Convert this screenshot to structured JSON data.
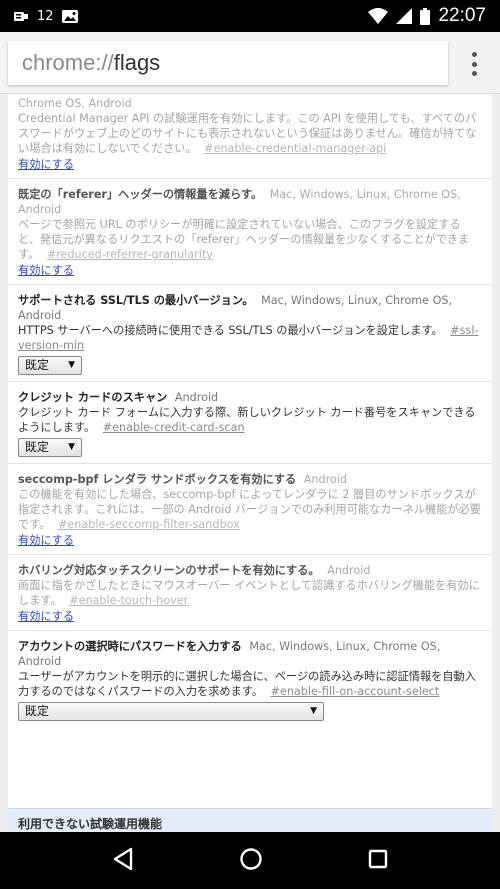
{
  "status_bar": {
    "notification_count": "12",
    "time": "22:07"
  },
  "omnibox": {
    "scheme": "chrome://",
    "host": "flags"
  },
  "flags": [
    {
      "name": "",
      "platforms": "Chrome OS, Android",
      "description": "Credential Manager API の試験運用を有効にします。この API を使用しても、すべてのパスワードがウェブ上のどのサイトにも表示されないという保証はありません。確信が持てない場合は有効にしないでください。",
      "anchor": "#enable-credential-manager-api",
      "action": "有効にする",
      "available": false
    },
    {
      "name": "既定の「referer」ヘッダーの情報量を減らす。",
      "platforms": "Mac, Windows, Linux, Chrome OS, Android",
      "description": "ページで参照元 URL のポリシーが明確に設定されていない場合、このフラグを設定すると、発信元が異なるリクエストの「referer」ヘッダーの情報量を少なくすることができます。",
      "anchor": "#reduced-referrer-granularity",
      "action": "有効にする",
      "available": false
    },
    {
      "name": "サポートされる SSL/TLS の最小バージョン。",
      "platforms": "Mac, Windows, Linux, Chrome OS, Android",
      "description": "HTTPS サーバーへの接続時に使用できる SSL/TLS の最小バージョンを設定します。",
      "anchor": "#ssl-version-min",
      "select_value": "既定",
      "available": true
    },
    {
      "name": "クレジット カードのスキャン",
      "platforms": "Android",
      "description": "クレジット カード フォームに入力する際、新しいクレジット カード番号をスキャンできるようにします。",
      "anchor": "#enable-credit-card-scan",
      "select_value": "既定",
      "available": true
    },
    {
      "name": "seccomp-bpf レンダラ サンドボックスを有効にする",
      "platforms": "Android",
      "description": "この機能を有効にした場合、seccomp-bpf によってレンダラに 2 層目のサンドボックスが指定されます。これには、一部の Android バージョンでのみ利用可能なカーネル機能が必要です。",
      "anchor": "#enable-seccomp-filter-sandbox",
      "action": "有効にする",
      "available": false
    },
    {
      "name": "ホバリング対応タッチスクリーンのサポートを有効にする。",
      "platforms": "Android",
      "description": "画面に指をかざしたときにマウスオーバー イベントとして認識するホバリング機能を有効にします。",
      "anchor": "#enable-touch-hover",
      "action": "有効にする",
      "available": false
    },
    {
      "name": "アカウントの選択時にパスワードを入力する",
      "platforms": "Mac, Windows, Linux, Chrome OS, Android",
      "description": "ユーザーがアカウントを明示的に選択した場合に、ページの読み込み時に認証情報を自動入力するのではなくパスワードの入力を求めます。",
      "anchor": "#enable-fill-on-account-select",
      "select_value": "既定",
      "available": true
    }
  ],
  "section_title": "利用できない試験運用機能",
  "colors": {
    "status_bar": "#000000",
    "link": "#2a45c4",
    "section_bg": "#e3ecf9"
  },
  "icons": [
    "notification-icon",
    "photo-icon",
    "wifi-icon",
    "signal-icon",
    "battery-icon",
    "more-vert-icon",
    "back-icon",
    "home-icon",
    "recents-icon"
  ]
}
